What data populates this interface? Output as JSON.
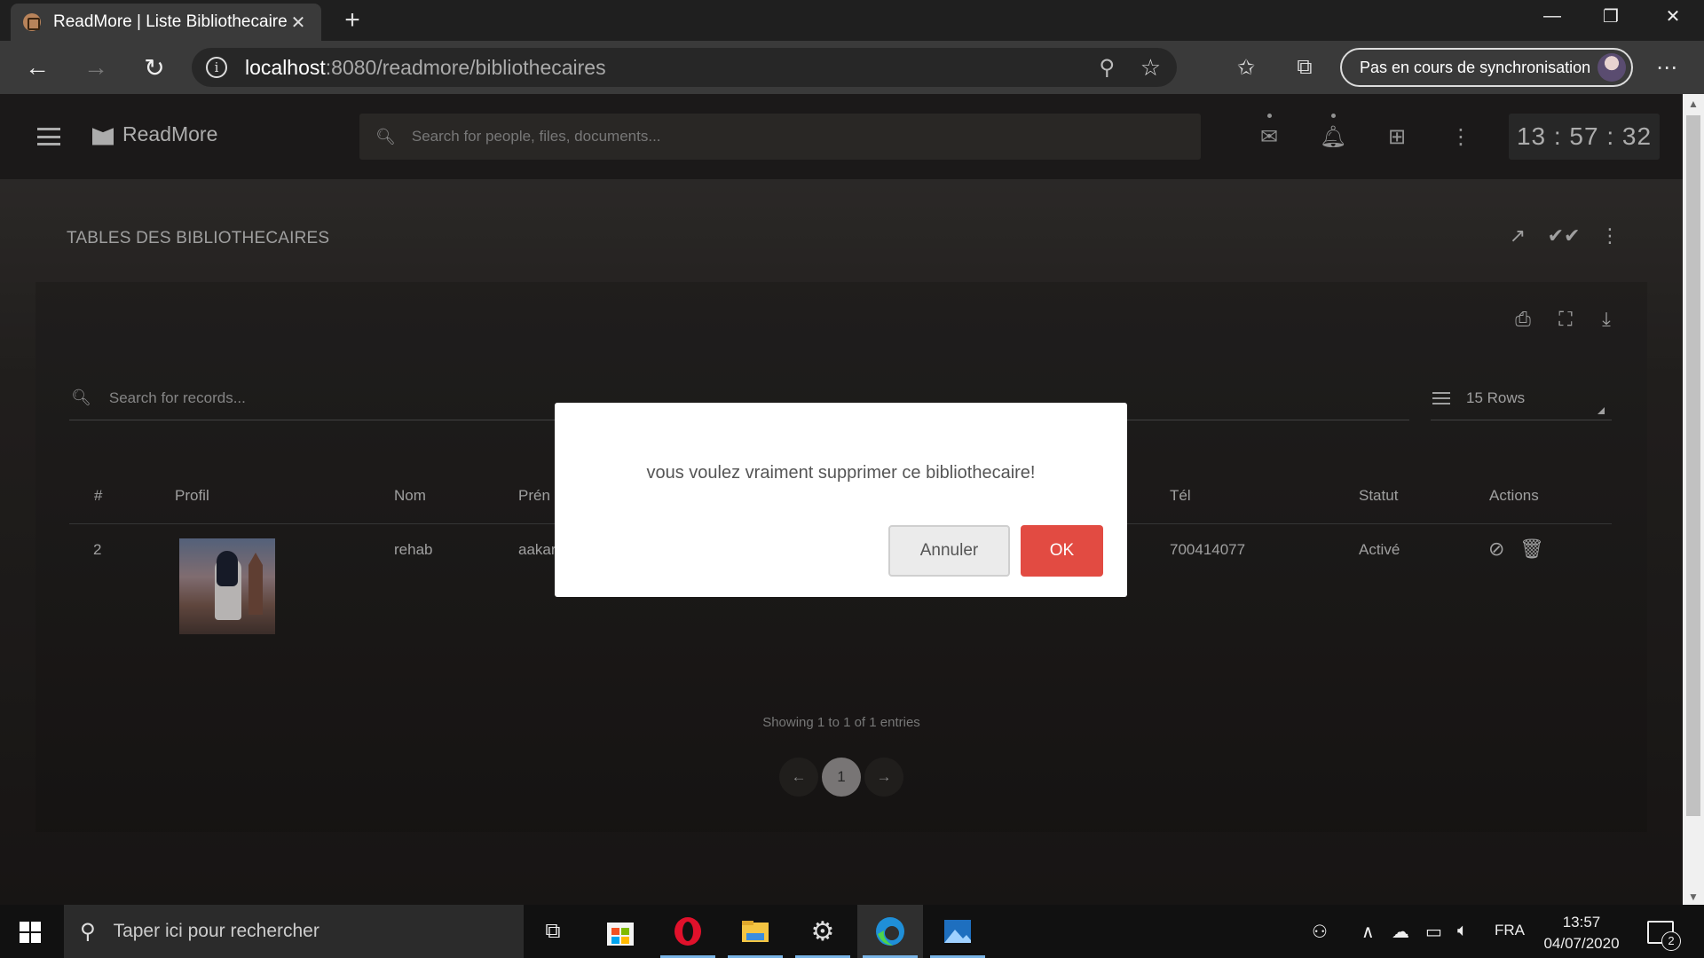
{
  "browser": {
    "tab_title": "ReadMore | Liste Bibliothecaire",
    "tab_close": "✕",
    "new_tab": "+",
    "url_host": "localhost",
    "url_path": ":8080/readmore/bibliothecaires",
    "sync_label": "Pas en cours de synchronisation",
    "window_controls": [
      "—",
      "❐",
      "✕"
    ]
  },
  "app": {
    "brand": "ReadMore",
    "search_placeholder": "Search for people, files, documents...",
    "clock": "13 : 57 : 32"
  },
  "section": {
    "title": "TABLES DES BIBLIOTHECAIRES"
  },
  "table": {
    "search_placeholder": "Search for records...",
    "rows_select": "15 Rows",
    "headers": [
      "#",
      "Profil",
      "Nom",
      "Prénom",
      "Tél",
      "Statut",
      "Actions"
    ],
    "visible_header_prenom": "Prén",
    "rows": [
      {
        "id": "2",
        "nom": "rehab",
        "prenom_visible": "aakar",
        "tel": "700414077",
        "statut": "Activé"
      }
    ],
    "showing": "Showing 1 to 1 of 1 entries",
    "current_page": "1",
    "prev": "←",
    "next": "→"
  },
  "dialog": {
    "message": "vous voulez vraiment supprimer ce bibliothecaire!",
    "cancel_label": "Annuler",
    "ok_label": "OK",
    "ok_color": "#e24b42"
  },
  "taskbar": {
    "search_placeholder": "Taper ici pour rechercher",
    "language": "FRA",
    "time": "13:57",
    "date": "04/07/2020",
    "notification_count": "2"
  }
}
